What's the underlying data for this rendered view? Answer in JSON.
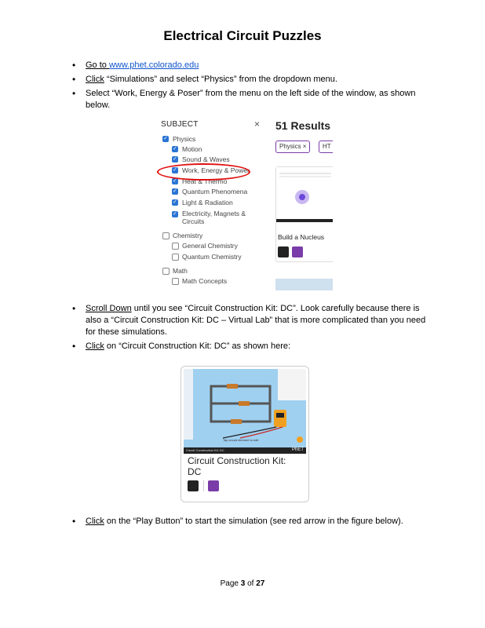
{
  "title": "Electrical Circuit Puzzles",
  "bullets1": {
    "b1_prefix": "Go to ",
    "b1_link": "www.phet.colorado.edu",
    "b2_action": "Click",
    "b2_rest": " “Simulations” and select “Physics” from the dropdown menu.",
    "b3": "Select “Work, Energy & Poser” from the menu on the left side of the window, as shown below."
  },
  "screenshot1": {
    "subject_label": "SUBJECT",
    "close": "×",
    "results": "51 Results",
    "filter_pills": [
      "Physics ×",
      "HT"
    ],
    "options": [
      {
        "label": "Physics",
        "checked": true,
        "indent": false
      },
      {
        "label": "Motion",
        "checked": true,
        "indent": true
      },
      {
        "label": "Sound & Waves",
        "checked": true,
        "indent": true
      },
      {
        "label": "Work, Energy & Power",
        "checked": true,
        "indent": true
      },
      {
        "label": "Heat & Thermo",
        "checked": true,
        "indent": true
      },
      {
        "label": "Quantum Phenomena",
        "checked": true,
        "indent": true
      },
      {
        "label": "Light & Radiation",
        "checked": true,
        "indent": true
      },
      {
        "label": "Electricity, Magnets &",
        "checked": true,
        "indent": true
      },
      {
        "label": "Circuits",
        "checked": null,
        "indent": true
      },
      {
        "label": "Chemistry",
        "checked": false,
        "indent": false
      },
      {
        "label": "General Chemistry",
        "checked": false,
        "indent": true
      },
      {
        "label": "Quantum Chemistry",
        "checked": false,
        "indent": true
      },
      {
        "label": "Math",
        "checked": false,
        "indent": false
      },
      {
        "label": "Math Concepts",
        "checked": false,
        "indent": true
      }
    ],
    "card_title": "Build a Nucleus"
  },
  "bullets2": {
    "b4_action": "Scroll Down",
    "b4_rest": " until you see “Circuit Construction Kit: DC”.  Look carefully because there is also a “Circuit Construction Kit: DC – Virtual Lab” that is more complicated than you need for these simulations.",
    "b5_action": "Click",
    "b5_rest": " on “Circuit Construction Kit: DC” as shown here:"
  },
  "screenshot2": {
    "card_title_line1": "Circuit Construction Kit:",
    "card_title_line2": "DC",
    "sim_caption": "Tap circuit element to edit",
    "bar_left": "Circuit Construction Kit: DC",
    "bar_right": "PhET"
  },
  "bullets3": {
    "b6_action": "Click",
    "b6_rest": " on the “Play Button” to start the simulation (see red arrow in the figure below)."
  },
  "footer": {
    "prefix": "Page ",
    "page": "3",
    "middle": " of ",
    "total": "27"
  },
  "colors": {
    "checkbox": "#2a75d3",
    "highlight_oval": "#e01010",
    "phet_purple": "#7a3ca8",
    "link": "#1155cc"
  }
}
